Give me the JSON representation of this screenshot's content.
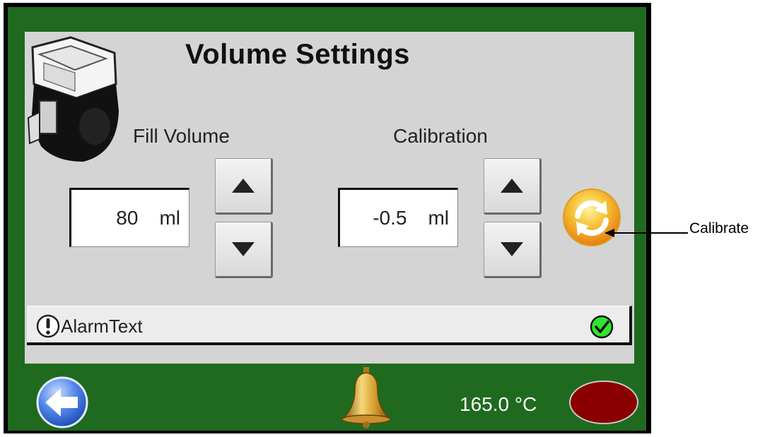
{
  "header": {
    "title": "Volume Settings"
  },
  "fill_volume": {
    "label": "Fill Volume",
    "value": "80",
    "unit": "ml"
  },
  "calibration": {
    "label": "Calibration",
    "value": "-0.5",
    "unit": "ml"
  },
  "alarm": {
    "text": "AlarmText"
  },
  "footer": {
    "temperature": "165.0 °C"
  },
  "annotation": {
    "calibrate_label": "Calibrate"
  },
  "colors": {
    "panel_green": "#1f6a1f",
    "panel_gray": "#d4d4d4",
    "status_oval": "#8a0000",
    "calibrate_orange": "#f5a623"
  },
  "icons": {
    "back": "back-arrow-icon",
    "bell": "bell-icon",
    "calibrate": "refresh-icon",
    "alarm": "exclamation-icon",
    "ok": "checkmark-icon",
    "pump": "pump-device-icon"
  }
}
